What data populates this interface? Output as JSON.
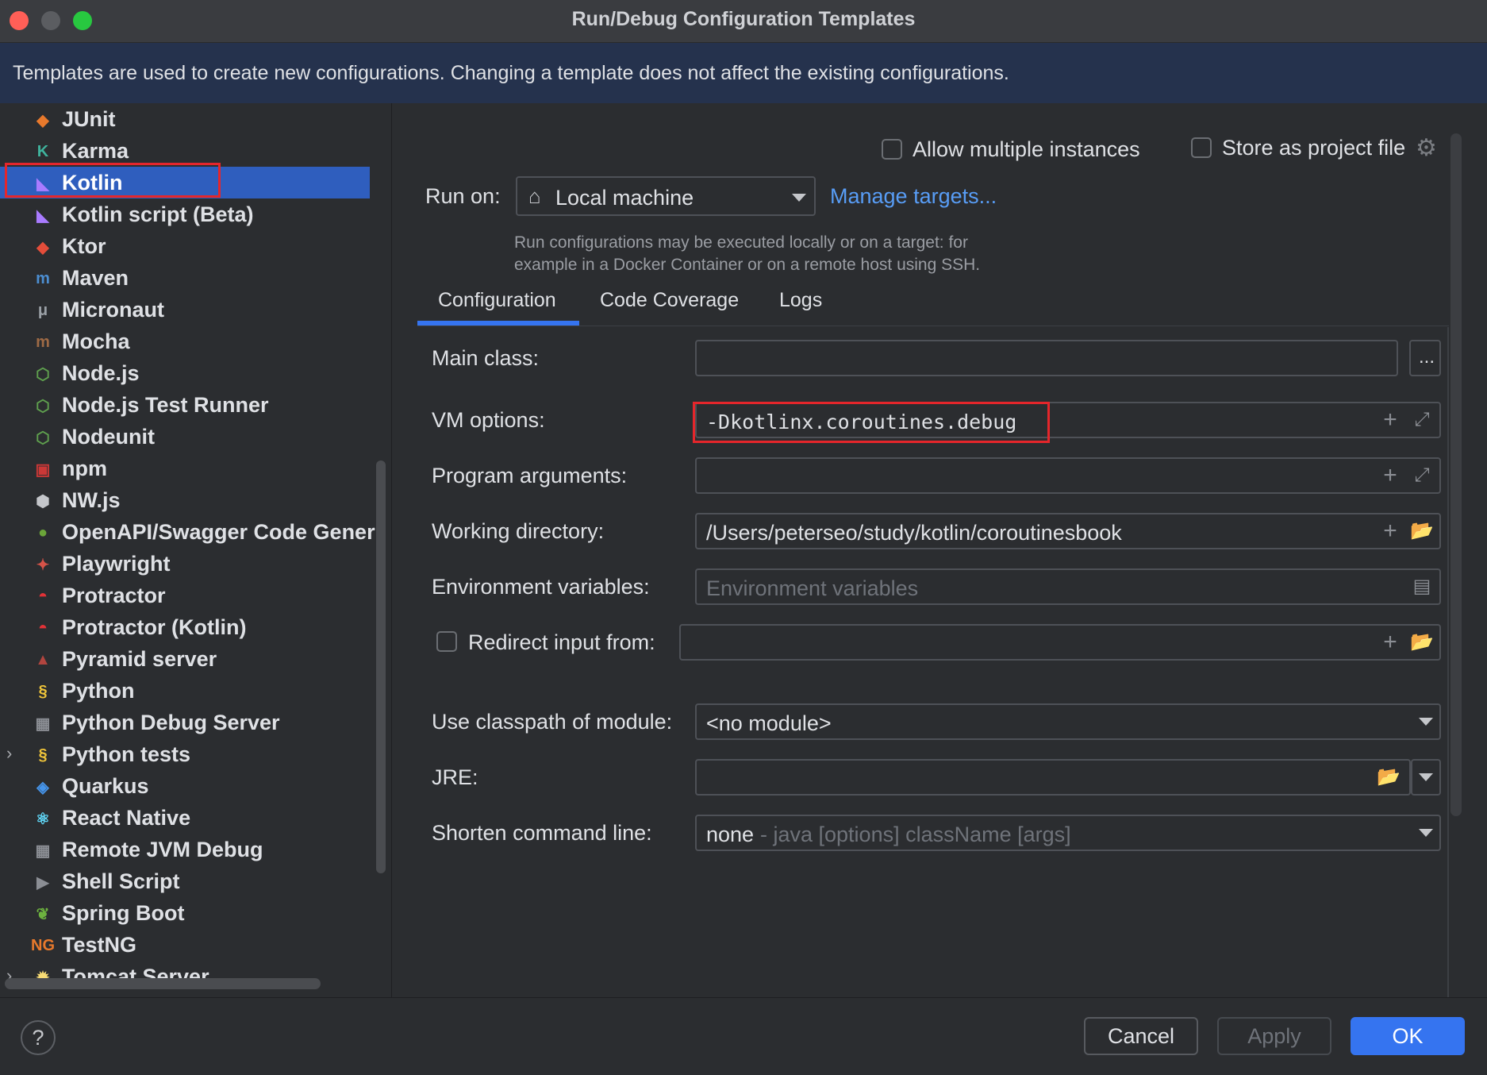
{
  "window": {
    "title": "Run/Debug Configuration Templates"
  },
  "banner": {
    "text": "Templates are used to create new configurations. Changing a template does not affect the existing configurations."
  },
  "sidebar": {
    "items": [
      {
        "label": "JUnit",
        "icon": "junit-icon"
      },
      {
        "label": "Karma",
        "icon": "karma-icon"
      },
      {
        "label": "Kotlin",
        "icon": "kotlin-icon",
        "selected": true
      },
      {
        "label": "Kotlin script (Beta)",
        "icon": "kotlin-icon"
      },
      {
        "label": "Ktor",
        "icon": "ktor-icon"
      },
      {
        "label": "Maven",
        "icon": "maven-icon"
      },
      {
        "label": "Micronaut",
        "icon": "micronaut-icon"
      },
      {
        "label": "Mocha",
        "icon": "mocha-icon"
      },
      {
        "label": "Node.js",
        "icon": "nodejs-icon"
      },
      {
        "label": "Node.js Test Runner",
        "icon": "nodejs-icon"
      },
      {
        "label": "Nodeunit",
        "icon": "nodejs-icon"
      },
      {
        "label": "npm",
        "icon": "npm-icon"
      },
      {
        "label": "NW.js",
        "icon": "nwjs-icon"
      },
      {
        "label": "OpenAPI/Swagger Code Generi",
        "icon": "openapi-icon"
      },
      {
        "label": "Playwright",
        "icon": "playwright-icon"
      },
      {
        "label": "Protractor",
        "icon": "protractor-icon"
      },
      {
        "label": "Protractor (Kotlin)",
        "icon": "protractor-icon"
      },
      {
        "label": "Pyramid server",
        "icon": "pyramid-icon"
      },
      {
        "label": "Python",
        "icon": "python-icon"
      },
      {
        "label": "Python Debug Server",
        "icon": "debug-server-icon"
      },
      {
        "label": "Python tests",
        "icon": "python-icon",
        "expandable": true
      },
      {
        "label": "Quarkus",
        "icon": "quarkus-icon"
      },
      {
        "label": "React Native",
        "icon": "react-icon"
      },
      {
        "label": "Remote JVM Debug",
        "icon": "debug-server-icon"
      },
      {
        "label": "Shell Script",
        "icon": "shell-icon"
      },
      {
        "label": "Spring Boot",
        "icon": "spring-icon"
      },
      {
        "label": "TestNG",
        "icon": "testng-icon"
      },
      {
        "label": "Tomcat Server",
        "icon": "tomcat-icon",
        "expandable": true
      }
    ]
  },
  "options": {
    "allow_multiple": "Allow multiple instances",
    "store_project": "Store as project file"
  },
  "run_on": {
    "label": "Run on:",
    "value": "Local machine",
    "manage": "Manage targets...",
    "hint_line1": "Run configurations may be executed locally or on a target: for",
    "hint_line2": "example in a Docker Container or on a remote host using SSH."
  },
  "tabs": [
    "Configuration",
    "Code Coverage",
    "Logs"
  ],
  "form": {
    "main_class": {
      "label": "Main class:",
      "value": "",
      "browse": "..."
    },
    "vm_options": {
      "label": "VM options:",
      "value": "-Dkotlinx.coroutines.debug"
    },
    "program_args": {
      "label": "Program arguments:",
      "value": ""
    },
    "working_dir": {
      "label": "Working directory:",
      "value": "/Users/peterseo/study/kotlin/coroutinesbook"
    },
    "env_vars": {
      "label": "Environment variables:",
      "placeholder": "Environment variables"
    },
    "redirect": {
      "label": "Redirect input from:",
      "value": ""
    },
    "classpath": {
      "label": "Use classpath of module:",
      "value": "<no module>"
    },
    "jre": {
      "label": "JRE:",
      "value": ""
    },
    "shorten": {
      "label": "Shorten command line:",
      "value": "none",
      "hint": "- java [options] className [args]"
    }
  },
  "buttons": {
    "help": "?",
    "cancel": "Cancel",
    "apply": "Apply",
    "ok": "OK"
  },
  "colors": {
    "accent": "#3574f0",
    "selection": "#2f5ebe",
    "highlight": "#e5262b",
    "banner": "#25324d"
  }
}
